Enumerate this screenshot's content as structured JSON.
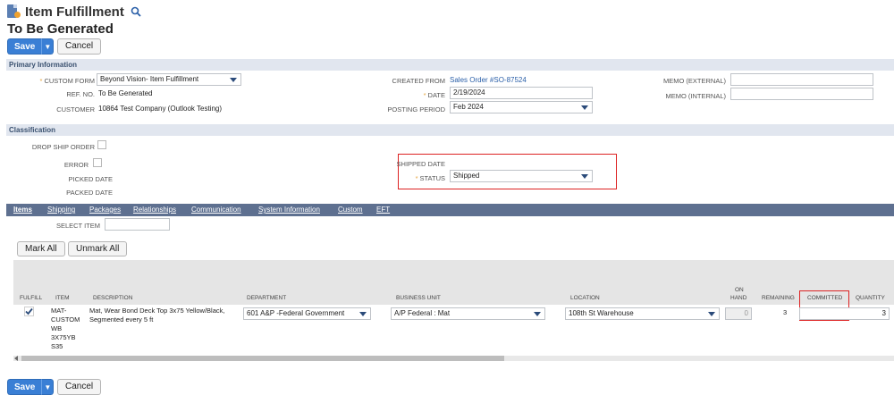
{
  "header": {
    "title": "Item Fulfillment",
    "status_title": "To Be Generated"
  },
  "buttons": {
    "save": "Save",
    "cancel": "Cancel",
    "save_arrow": "▼"
  },
  "primary": {
    "section_title": "Primary Information",
    "custom_form_label": "CUSTOM FORM",
    "custom_form_value": "Beyond Vision- Item Fulfillment",
    "ref_no_label": "REF. NO.",
    "ref_no_value": "To Be Generated",
    "customer_label": "CUSTOMER",
    "customer_value": "10864 Test Company (Outlook Testing)",
    "created_from_label": "CREATED FROM",
    "created_from_value": "Sales Order #SO-87524",
    "date_label": "DATE",
    "date_value": "2/19/2024",
    "posting_period_label": "POSTING PERIOD",
    "posting_period_value": "Feb 2024",
    "memo_external_label": "MEMO (EXTERNAL)",
    "memo_external_value": "",
    "memo_internal_label": "MEMO (INTERNAL)",
    "memo_internal_value": ""
  },
  "classification": {
    "section_title": "Classification",
    "drop_ship_label": "DROP SHIP ORDER",
    "drop_ship_checked": false,
    "error_label": "ERROR",
    "error_checked": false,
    "picked_date_label": "PICKED DATE",
    "packed_date_label": "PACKED DATE",
    "shipped_date_label": "SHIPPED DATE",
    "status_label": "STATUS",
    "status_value": "Shipped"
  },
  "tabs": [
    "Items",
    "Shipping",
    "Packages",
    "Relationships",
    "Communication",
    "System Information",
    "Custom",
    "EFT"
  ],
  "items": {
    "select_item_label": "SELECT ITEM",
    "mark_all": "Mark All",
    "unmark_all": "Unmark All",
    "columns": {
      "fulfill": "FULFILL",
      "item": "ITEM",
      "description": "DESCRIPTION",
      "department": "DEPARTMENT",
      "business_unit": "BUSINESS UNIT",
      "location": "LOCATION",
      "on": "ON",
      "hand": "HAND",
      "remaining": "REMAINING",
      "committed": "COMMITTED",
      "quantity": "QUANTITY"
    },
    "row": {
      "fulfill_checked": true,
      "item_lines": [
        "MAT-",
        "CUSTOM",
        "WB",
        "3X75YB",
        "S35"
      ],
      "description_lines": [
        "Mat, Wear Bond Deck Top 3x75 Yellow/Black,",
        "Segmented every 5 ft"
      ],
      "department": "601 A&P -Federal Government",
      "business_unit": "A/P Federal : Mat",
      "location": "108th St Warehouse",
      "on_hand": "0",
      "remaining": "3",
      "quantity": "3"
    }
  },
  "colors": {
    "accent": "#3a7fd5",
    "tabbar": "#5e7090",
    "highlight": "#dd2222",
    "required": "#e5a33b"
  }
}
